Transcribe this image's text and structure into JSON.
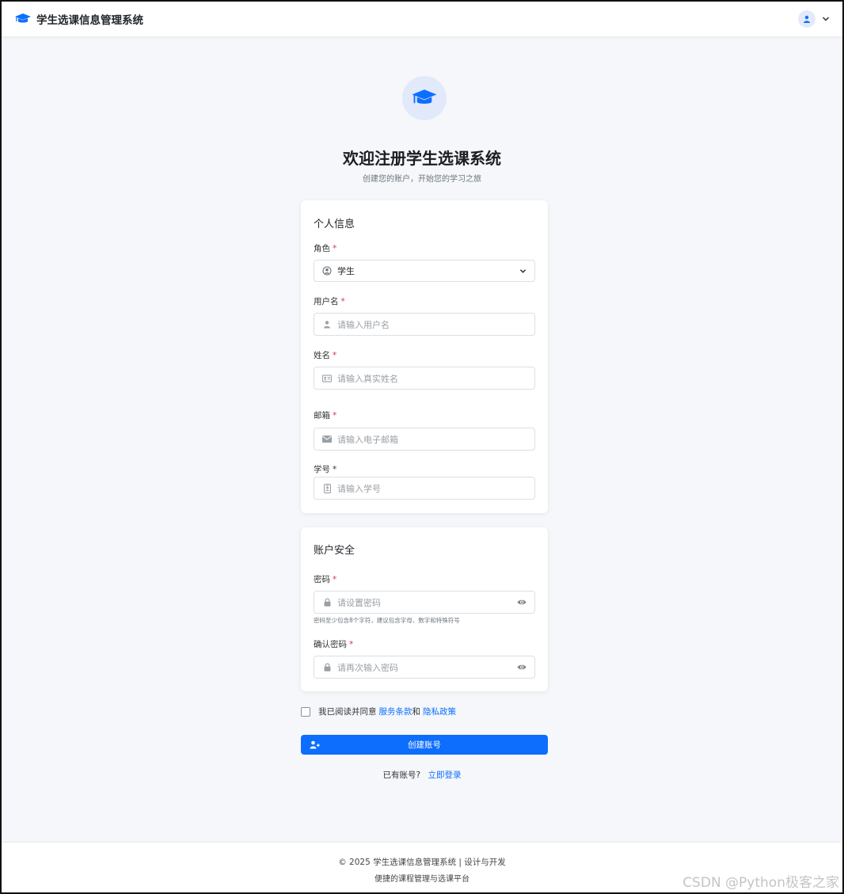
{
  "navbar": {
    "brand": "学生选课信息管理系统",
    "brand_icon": "graduation-cap-icon",
    "user_icon": "user-icon",
    "menu_icon": "chevron-down-icon"
  },
  "hero": {
    "icon": "graduation-cap-icon",
    "title": "欢迎注册学生选课系统",
    "subtitle": "创建您的账户，开始您的学习之旅"
  },
  "personal": {
    "title": "个人信息",
    "role": {
      "label": "角色",
      "required": "*",
      "value": "学生",
      "icon": "user-circle-icon"
    },
    "username": {
      "label": "用户名",
      "required": "*",
      "placeholder": "请输入用户名",
      "icon": "user-icon"
    },
    "realname": {
      "label": "姓名",
      "required": "*",
      "placeholder": "请输入真实姓名",
      "icon": "id-card-icon"
    },
    "email": {
      "label": "邮箱",
      "required": "*",
      "placeholder": "请输入电子邮箱",
      "icon": "envelope-icon"
    },
    "student_id": {
      "label": "学号",
      "required": "*",
      "placeholder": "请输入学号",
      "icon": "id-badge-icon"
    }
  },
  "security": {
    "title": "账户安全",
    "password": {
      "label": "密码",
      "required": "*",
      "placeholder": "请设置密码",
      "hint": "密码至少包含8个字符，建议包含字母、数字和特殊符号",
      "icon": "lock-icon"
    },
    "confirm": {
      "label": "确认密码",
      "required": "*",
      "placeholder": "请再次输入密码",
      "icon": "lock-icon"
    }
  },
  "agreement": {
    "text": "我已阅读并同意",
    "terms": "服务条款",
    "and": "和",
    "privacy": "隐私政策"
  },
  "submit_label": "创建账号",
  "login": {
    "prompt": "已有账号?",
    "link": "立即登录"
  },
  "footer": {
    "line1": "© 2025 学生选课信息管理系统 | 设计与开发",
    "line2": "便捷的课程管理与选课平台"
  },
  "watermark": "CSDN @Python极客之家",
  "colors": {
    "primary": "#0d6efd",
    "required": "#dc3545",
    "background": "#f5f7fa"
  }
}
